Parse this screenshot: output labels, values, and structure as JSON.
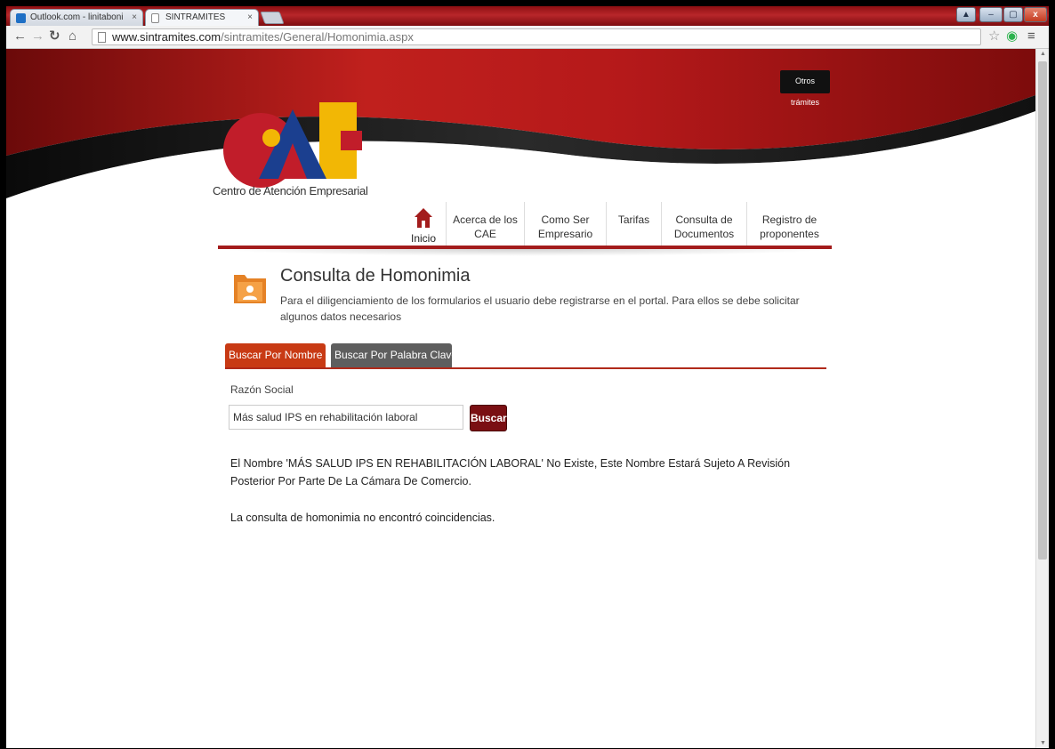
{
  "browser": {
    "tabs": [
      {
        "label": "Outlook.com - linitaboni",
        "favicon": "outlook-icon"
      },
      {
        "label": "SINTRAMITES",
        "favicon": "page-icon"
      }
    ],
    "address": {
      "host": "www.sintramites.com",
      "path": "/sintramites/General/Homonimia.aspx"
    },
    "controls": {
      "minimize": "–",
      "maximize": "▢",
      "close": "x"
    }
  },
  "header": {
    "other_procedures": "Otros trámites",
    "logo_text": "Centro de Atención Empresarial",
    "logo_letters": "CAE"
  },
  "nav": {
    "home": "Inicio",
    "items": [
      {
        "label": "Acerca de los CAE"
      },
      {
        "label": "Como Ser Empresario"
      },
      {
        "label": "Tarifas"
      },
      {
        "label": "Consulta de Documentos"
      },
      {
        "label": "Registro de proponentes"
      }
    ]
  },
  "main": {
    "title": "Consulta de Homonimia",
    "subtitle": "Para el diligenciamiento de los formularios el usuario debe registrarse en el portal. Para ellos se debe solicitar algunos datos necesarios",
    "tabs": [
      {
        "label": "Buscar Por Nombre",
        "active": true
      },
      {
        "label": "Buscar Por Palabra Clave",
        "active": false
      }
    ],
    "field_label": "Razón Social",
    "search_value": "Más salud IPS en rehabilitación laboral",
    "search_button": "Buscar",
    "result_message": "El Nombre 'MÁS SALUD IPS EN REHABILITACIÓN LABORAL' No Existe, Este Nombre Estará Sujeto A Revisión Posterior Por Parte De La Cámara De Comercio.",
    "no_match_message": "La consulta de homonimia no encontró coincidencias."
  },
  "colors": {
    "brand_red": "#a31c1c",
    "tab_active": "#c83a14",
    "tab_inactive": "#5e5e5e",
    "button": "#7a0f13"
  }
}
